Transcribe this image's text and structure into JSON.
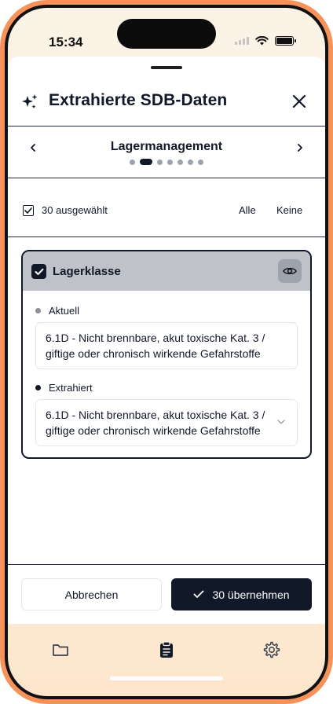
{
  "status_bar": {
    "time": "15:34"
  },
  "sheet": {
    "title": "Extrahierte SDB-Daten",
    "section_title": "Lagermanagement",
    "page_indicator": {
      "total": 7,
      "active_index": 1
    }
  },
  "selection": {
    "count_label": "30 ausgewählt",
    "all_label": "Alle",
    "none_label": "Keine"
  },
  "card": {
    "title": "Lagerklasse",
    "current_label": "Aktuell",
    "current_value": "6.1D - Nicht brennbare, akut toxische Kat. 3 / giftige oder chronisch wirkende Gefahrstoffe",
    "extracted_label": "Extrahiert",
    "extracted_value": "6.1D - Nicht brennbare, akut toxische Kat. 3 / giftige oder chronisch wirkende Gefahrstoffe"
  },
  "footer": {
    "cancel_label": "Abbrechen",
    "apply_label": "30 übernehmen"
  },
  "tabbar": {
    "items": [
      {
        "icon": "folder-icon"
      },
      {
        "icon": "clipboard-icon"
      },
      {
        "icon": "gear-icon"
      }
    ]
  },
  "colors": {
    "primary": "#111827",
    "frame_accent": "#f7935a",
    "card_header": "#bfc2c8",
    "current_bullet": "#8a8f98",
    "extracted_bullet": "#111827"
  }
}
